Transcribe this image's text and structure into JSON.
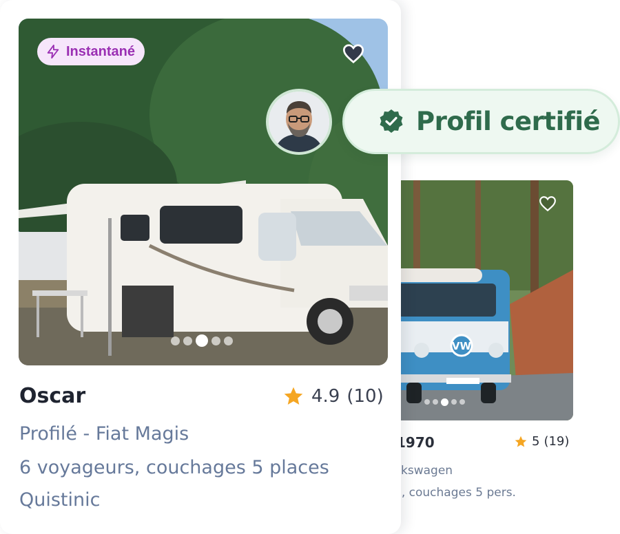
{
  "certified_badge": {
    "label": "Profil certifié",
    "icon": "check-shield-icon",
    "color": "#2f6b4c"
  },
  "listing_main": {
    "badge_label": "Instantané",
    "badge_icon": "lightning-icon",
    "title": "Oscar",
    "rating_value": "4.9",
    "rating_count": "(10)",
    "model": "Profilé - Fiat Magis",
    "capacity": "6 voyageurs, couchages 5 places",
    "location": "Quistinic",
    "photo_index": 3,
    "photo_total": 5,
    "accent": "#9a2fb3"
  },
  "listing_secondary": {
    "title": "1970",
    "rating_value": "5",
    "rating_count": "(19)",
    "model": "kswagen",
    "capacity": "s, couchages 5 pers.",
    "photo_index": 3,
    "photo_total": 5
  },
  "colors": {
    "star": "#f5a623",
    "heart_fill": "#333a4a",
    "subtext": "#66799a"
  }
}
